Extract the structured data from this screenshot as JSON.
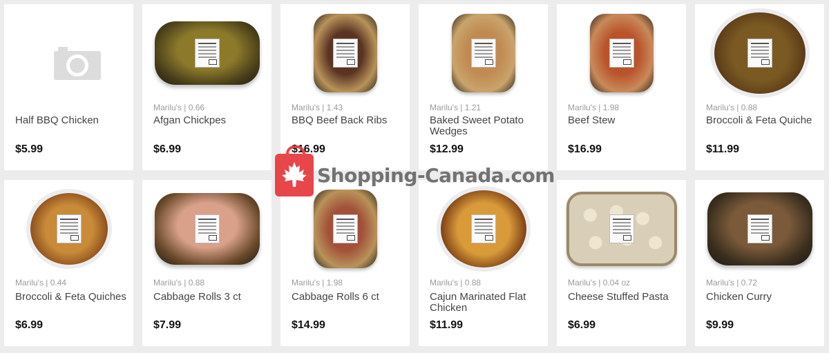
{
  "products": [
    {
      "meta": "",
      "title": "Half BBQ Chicken",
      "price": "$5.99",
      "image": "camera-placeholder-icon"
    },
    {
      "meta": "Marilu's | 0.66",
      "title": "Afgan Chickpes",
      "price": "$6.99",
      "image": "tray-wide"
    },
    {
      "meta": "Marilu's | 1.43",
      "title": "BBQ Beef Back Ribs",
      "price": "$16.99",
      "image": "tray-tall"
    },
    {
      "meta": "Marilu's | 1.21",
      "title": "Baked Sweet Potato Wedges",
      "price": "$12.99",
      "image": "tray-tall"
    },
    {
      "meta": "Marilu's | 1.98",
      "title": "Beef Stew",
      "price": "$16.99",
      "image": "tray-tall"
    },
    {
      "meta": "Marilu's | 0.88",
      "title": "Broccoli & Feta Quiche",
      "price": "$11.99",
      "image": "quiche"
    },
    {
      "meta": "Marilu's | 0.44",
      "title": "Broccoli & Feta Quiches",
      "price": "$6.99",
      "image": "quiche"
    },
    {
      "meta": "Marilu's | 0.88",
      "title": "Cabbage Rolls 3 ct",
      "price": "$7.99",
      "image": "tray-wide"
    },
    {
      "meta": "Marilu's | 1.98",
      "title": "Cabbage Rolls 6 ct",
      "price": "$14.99",
      "image": "tray-tall"
    },
    {
      "meta": "Marilu's | 0.88",
      "title": "Cajun Marinated Flat Chicken",
      "price": "$11.99",
      "image": "quiche"
    },
    {
      "meta": "Marilu's | 0.04 oz",
      "title": "Cheese Stuffed Pasta",
      "price": "$6.99",
      "image": "pasta-tray"
    },
    {
      "meta": "Marilu's | 0.72",
      "title": "Chicken Curry",
      "price": "$9.99",
      "image": "tray-wide"
    }
  ],
  "watermark": {
    "text": "Shopping-Canada.com",
    "icon": "maple-leaf-bag-icon",
    "color": "#e5383b"
  }
}
